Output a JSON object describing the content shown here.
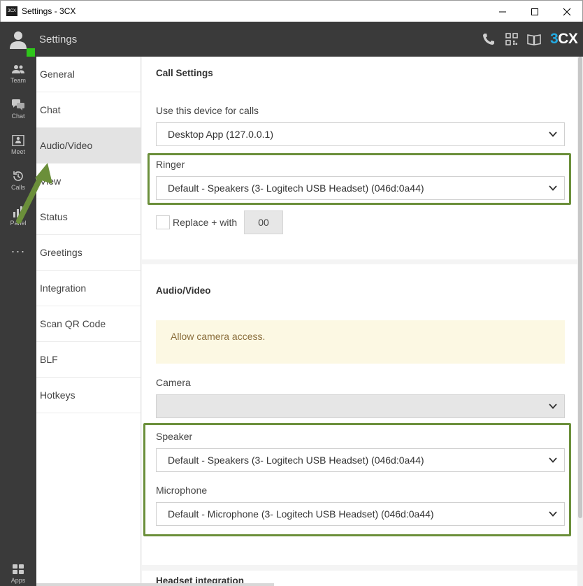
{
  "window": {
    "title": "Settings - 3CX",
    "app_icon_text": "3CX"
  },
  "header": {
    "title": "Settings",
    "logo_prefix": "3",
    "logo_suffix": "CX",
    "icons": [
      "phone-icon",
      "qr-code-icon",
      "book-icon"
    ]
  },
  "rail": {
    "items": [
      {
        "label": "Team",
        "icon": "team-icon"
      },
      {
        "label": "Chat",
        "icon": "chat-icon"
      },
      {
        "label": "Meet",
        "icon": "meet-icon"
      },
      {
        "label": "Calls",
        "icon": "calls-icon"
      },
      {
        "label": "Panel",
        "icon": "panel-icon"
      }
    ],
    "more": "···",
    "apps": {
      "label": "Apps",
      "icon": "apps-icon"
    }
  },
  "settings_nav": {
    "items": [
      {
        "label": "General"
      },
      {
        "label": "Chat"
      },
      {
        "label": "Audio/Video",
        "active": true
      },
      {
        "label": "View"
      },
      {
        "label": "Status"
      },
      {
        "label": "Greetings"
      },
      {
        "label": "Integration"
      },
      {
        "label": "Scan QR Code"
      },
      {
        "label": "BLF"
      },
      {
        "label": "Hotkeys"
      }
    ]
  },
  "call_settings": {
    "title": "Call Settings",
    "device_label": "Use this device for calls",
    "device_value": "Desktop App (127.0.0.1)",
    "ringer_label": "Ringer",
    "ringer_value": "Default - Speakers (3- Logitech USB Headset) (046d:0a44)",
    "replace_label": "Replace + with",
    "replace_checked": false,
    "replace_value": "00"
  },
  "audio_video": {
    "title": "Audio/Video",
    "notice": "Allow camera access.",
    "camera_label": "Camera",
    "camera_value": "",
    "speaker_label": "Speaker",
    "speaker_value": "Default - Speakers (3- Logitech USB Headset) (046d:0a44)",
    "microphone_label": "Microphone",
    "microphone_value": "Default - Microphone (3- Logitech USB Headset) (046d:0a44)"
  },
  "headset": {
    "title": "Headset integration"
  },
  "colors": {
    "header_bg": "#3a3a3a",
    "presence": "#2ec51a",
    "highlight": "#6b8f3a",
    "notice_bg": "#fcf8e3",
    "notice_text": "#8a6d3b",
    "logo_accent": "#23a9e1"
  }
}
